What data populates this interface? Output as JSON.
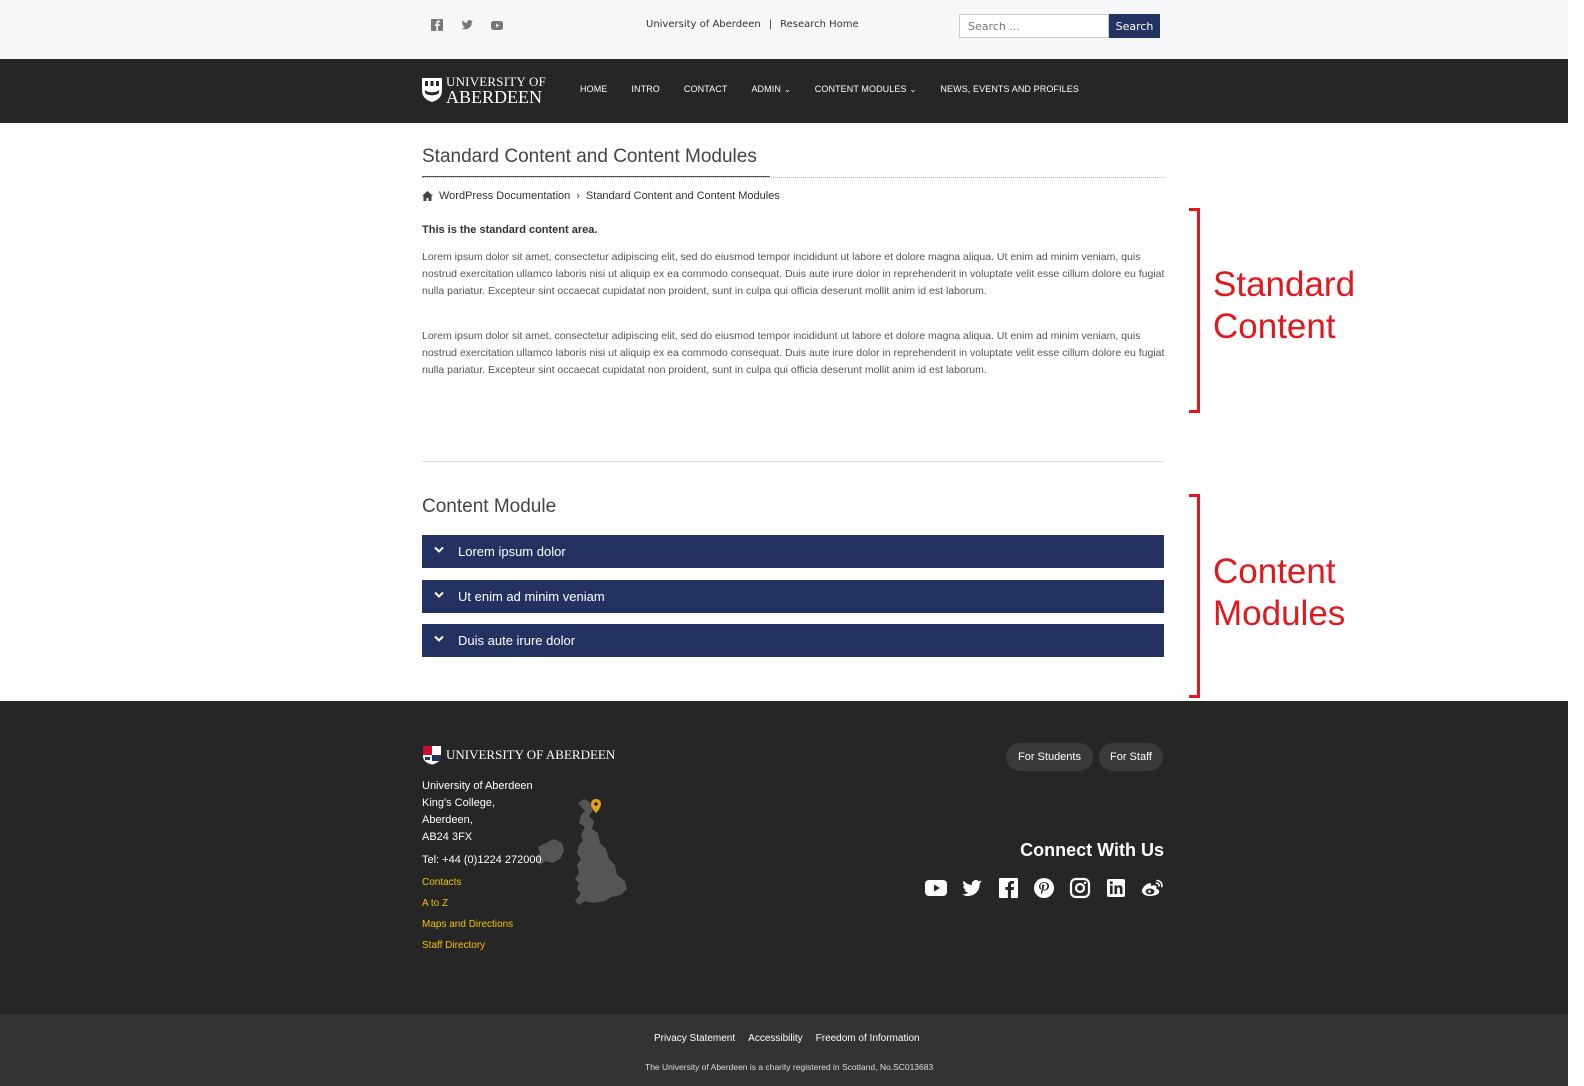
{
  "topbar": {
    "social_icons": [
      "facebook-icon",
      "twitter-icon",
      "youtube-icon"
    ],
    "links": [
      "University of Aberdeen",
      "|",
      "Research Home"
    ],
    "search_placeholder": "Search ...",
    "search_button": "Search"
  },
  "nav": {
    "logo_line1": "UNIVERSITY OF",
    "logo_line2": "ABERDEEN",
    "items": [
      "HOME",
      "INTRO",
      "CONTACT",
      "ADMIN",
      "CONTENT MODULES",
      "NEWS, EVENTS AND PROFILES"
    ]
  },
  "main": {
    "title": "Standard Content and Content Modules",
    "breadcrumb": [
      "WordPress Documentation",
      "Standard Content and Content Modules"
    ],
    "intro": "This is the standard content area.",
    "paragraphs": [
      "Lorem ipsum dolor sit amet, consectetur adipiscing elit, sed do eiusmod tempor incididunt ut labore et dolore magna aliqua. Ut enim ad minim veniam, quis nostrud exercitation ullamco laboris nisi ut aliquip ex ea commodo consequat. Duis aute irure dolor in reprehenderit in voluptate velit esse cillum dolore eu fugiat nulla pariatur. Excepteur sint occaecat cupidatat non proident, sunt in culpa qui officia deserunt mollit anim id est laborum.",
      "Lorem ipsum dolor sit amet, consectetur adipiscing elit, sed do eiusmod tempor incididunt ut labore et dolore magna aliqua. Ut enim ad minim veniam, quis nostrud exercitation ullamco laboris nisi ut aliquip ex ea commodo consequat. Duis aute irure dolor in reprehenderit in voluptate velit esse cillum dolore eu fugiat nulla pariatur. Excepteur sint occaecat cupidatat non proident, sunt in culpa qui officia deserunt mollit anim id est laborum."
    ],
    "module_title": "Content Module",
    "accordion": [
      "Lorem ipsum dolor",
      "Ut enim ad minim veniam",
      "Duis aute irure dolor"
    ]
  },
  "annotations": {
    "standard_1": "Standard",
    "standard_2": "Content",
    "modules_1": "Content",
    "modules_2": "Modules"
  },
  "footer": {
    "logo_text": "UNIVERSITY OF ABERDEEN",
    "address": [
      "University of Aberdeen",
      "King's College,",
      "Aberdeen,",
      "AB24 3FX"
    ],
    "tel": "Tel: +44 (0)1224 272000",
    "links": [
      "Contacts",
      "A to Z",
      "Maps and Directions",
      "Staff Directory"
    ],
    "for_students": "For Students",
    "for_staff": "For Staff",
    "connect": "Connect With Us",
    "social_icons": [
      "youtube-icon",
      "twitter-icon",
      "facebook-icon",
      "pinterest-icon",
      "instagram-icon",
      "linkedin-icon",
      "weibo-icon"
    ],
    "legal_links": [
      "Privacy Statement",
      "Accessibility",
      "Freedom of Information"
    ],
    "charity": "The University of Aberdeen is a charity registered in Scotland, No.SC013683"
  },
  "colors": {
    "brand_navy": "#243262",
    "dark_bar": "#262626",
    "footer_link": "#f2c200",
    "annotation_red": "#e0191e"
  }
}
